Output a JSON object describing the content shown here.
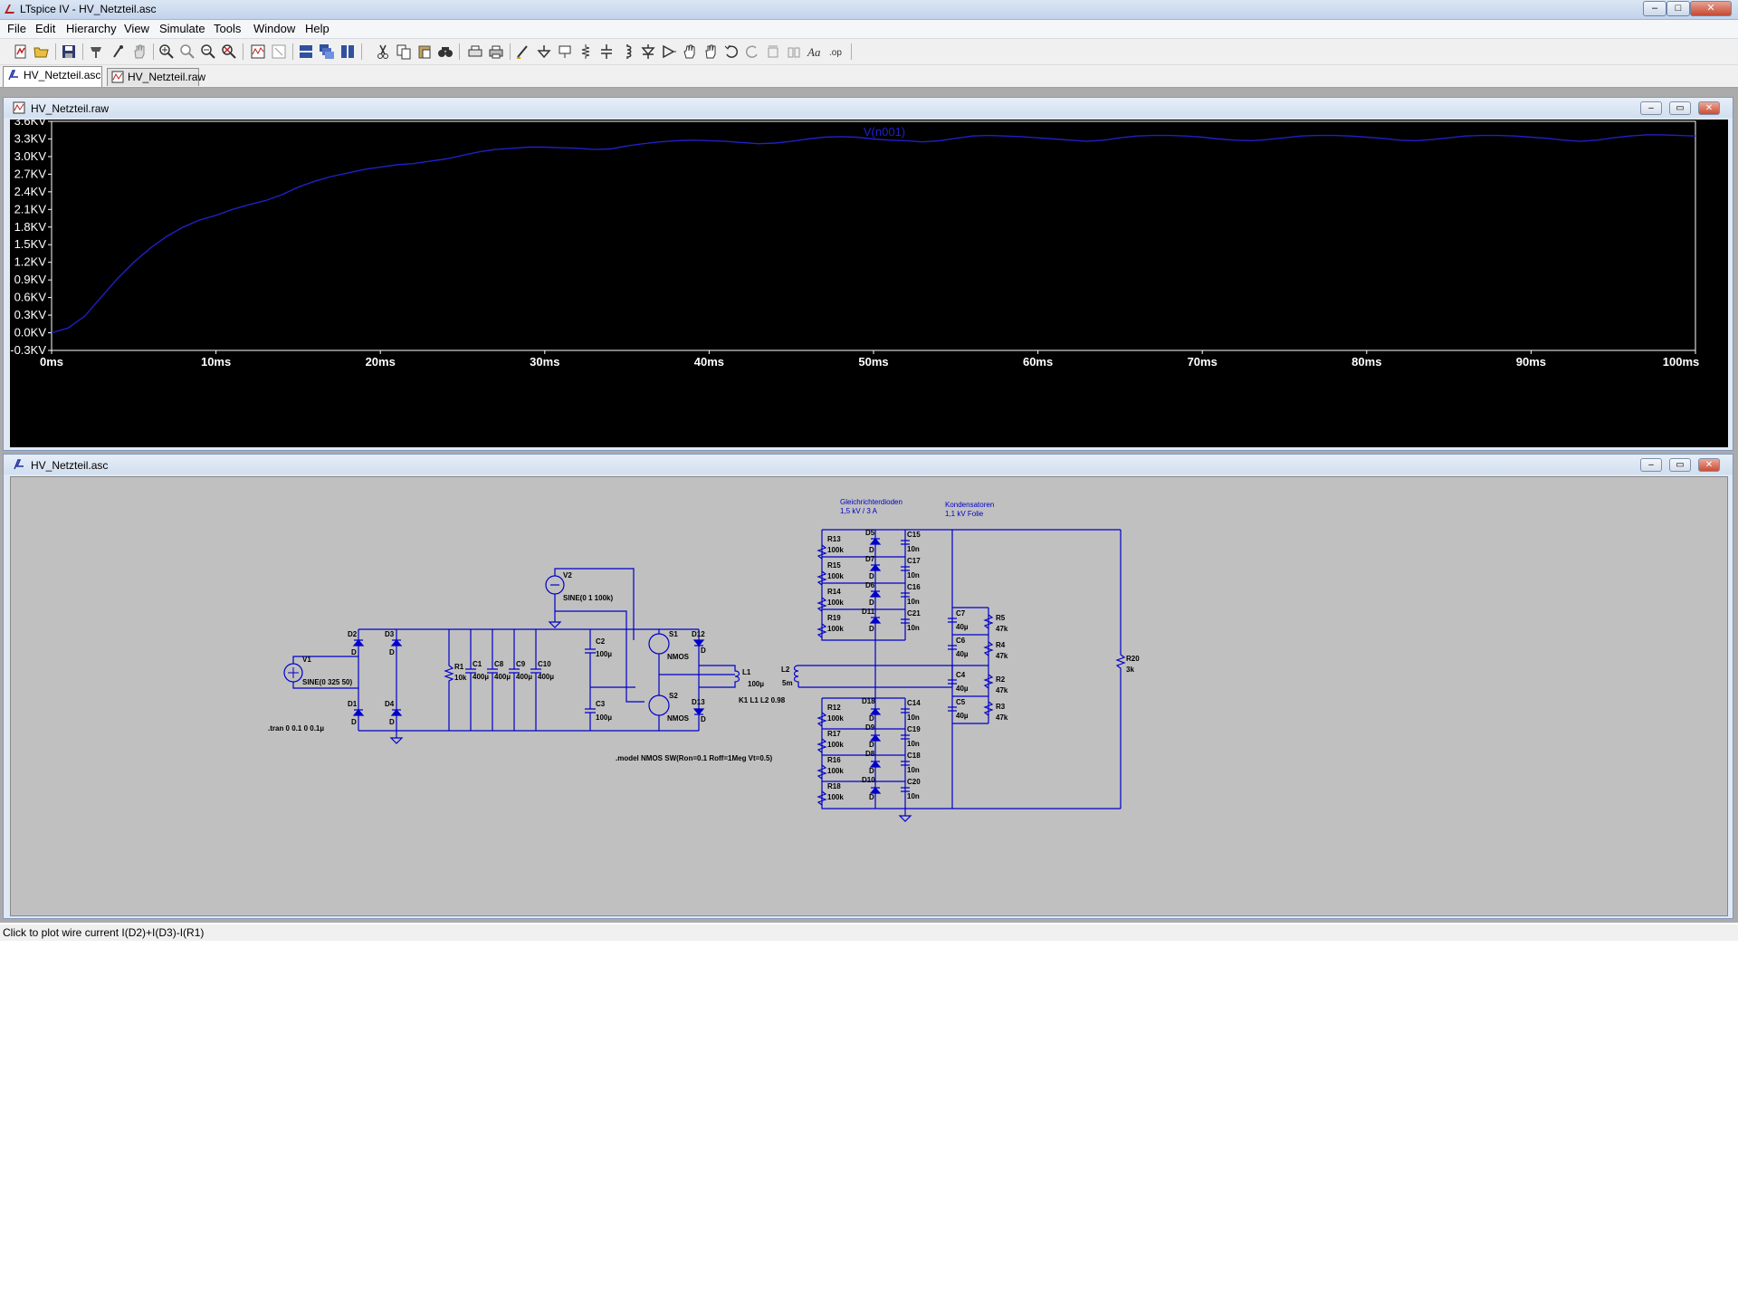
{
  "window": {
    "title": "LTspice IV - HV_Netzteil.asc",
    "min": "–",
    "max": "□",
    "close": "✕"
  },
  "menu": [
    "File",
    "Edit",
    "Hierarchy",
    "View",
    "Simulate",
    "Tools",
    "Window",
    "Help"
  ],
  "tabs": [
    {
      "label": "HV_Netzteil.asc",
      "active": true
    },
    {
      "label": "HV_Netzteil.raw",
      "active": false
    }
  ],
  "plot_window": {
    "title": "HV_Netzteil.raw",
    "trace_label": "V(n001)",
    "min": "–",
    "restore": "▭",
    "close": "✕"
  },
  "chart_data": {
    "type": "line",
    "series": [
      {
        "name": "V(n001)",
        "x": [
          0,
          1,
          2,
          3,
          4,
          5,
          6,
          7,
          8,
          9,
          10,
          11,
          12,
          13,
          14,
          15,
          16,
          17,
          18,
          19,
          20,
          21,
          22,
          23,
          24,
          25,
          26,
          27,
          28,
          29,
          30,
          31,
          32,
          33,
          34,
          35,
          36,
          37,
          38,
          39,
          40,
          41,
          42,
          43,
          44,
          45,
          46,
          47,
          48,
          49,
          50,
          51,
          52,
          53,
          54,
          55,
          56,
          57,
          58,
          59,
          60,
          61,
          62,
          63,
          64,
          65,
          66,
          67,
          68,
          69,
          70,
          71,
          72,
          73,
          74,
          75,
          76,
          77,
          78,
          79,
          80,
          81,
          82,
          83,
          84,
          85,
          86,
          87,
          88,
          89,
          90,
          91,
          92,
          93,
          94,
          95,
          96,
          97,
          98,
          99,
          100
        ],
        "y": [
          0.0,
          0.08,
          0.28,
          0.6,
          0.92,
          1.2,
          1.44,
          1.64,
          1.8,
          1.92,
          2.0,
          2.1,
          2.18,
          2.25,
          2.35,
          2.48,
          2.58,
          2.66,
          2.72,
          2.78,
          2.82,
          2.86,
          2.88,
          2.92,
          2.96,
          3.02,
          3.08,
          3.12,
          3.14,
          3.16,
          3.16,
          3.15,
          3.14,
          3.12,
          3.13,
          3.18,
          3.22,
          3.25,
          3.27,
          3.28,
          3.27,
          3.26,
          3.24,
          3.22,
          3.23,
          3.26,
          3.3,
          3.33,
          3.34,
          3.33,
          3.3,
          3.28,
          3.27,
          3.25,
          3.27,
          3.31,
          3.35,
          3.36,
          3.35,
          3.34,
          3.32,
          3.3,
          3.28,
          3.26,
          3.28,
          3.32,
          3.35,
          3.36,
          3.36,
          3.35,
          3.33,
          3.3,
          3.28,
          3.27,
          3.29,
          3.32,
          3.35,
          3.36,
          3.36,
          3.35,
          3.33,
          3.31,
          3.28,
          3.27,
          3.29,
          3.32,
          3.35,
          3.36,
          3.36,
          3.35,
          3.33,
          3.31,
          3.28,
          3.26,
          3.28,
          3.32,
          3.35,
          3.37,
          3.37,
          3.36,
          3.35
        ]
      }
    ],
    "xlim": [
      0,
      100
    ],
    "ylim": [
      -0.3,
      3.6
    ],
    "xticks": [
      0,
      10,
      20,
      30,
      40,
      50,
      60,
      70,
      80,
      90,
      100
    ],
    "xtick_labels": [
      "0ms",
      "10ms",
      "20ms",
      "30ms",
      "40ms",
      "50ms",
      "60ms",
      "70ms",
      "80ms",
      "90ms",
      "100ms"
    ],
    "yticks": [
      3.6,
      3.3,
      3.0,
      2.7,
      2.4,
      2.1,
      1.8,
      1.5,
      1.2,
      0.9,
      0.6,
      0.3,
      0.0,
      -0.3
    ],
    "ytick_labels": [
      "3.6KV",
      "3.3KV",
      "3.0KV",
      "2.7KV",
      "2.4KV",
      "2.1KV",
      "1.8KV",
      "1.5KV",
      "1.2KV",
      "0.9KV",
      "0.6KV",
      "0.3KV",
      "0.0KV",
      "-0.3KV"
    ],
    "grid": false,
    "line_color": "#2020c8",
    "background": "#000000"
  },
  "schematic_window": {
    "title": "HV_Netzteil.asc",
    "min": "–",
    "restore": "▭",
    "close": "✕"
  },
  "schematic": {
    "notes": {
      "rectifier_title": "Gleichrichterdioden",
      "rectifier_sub": "1,5 kV / 3 A",
      "cap_title": "Kondensatoren",
      "cap_sub": "1,1 kV Folie",
      "tran": ".tran 0 0.1 0 0.1µ",
      "model": ".model NMOS SW(Ron=0.1 Roff=1Meg Vt=0.5)",
      "coupling": "K1 L1 L2 0.98"
    },
    "sources": {
      "v1_name": "V1",
      "v1_value": "SINE(0 325 50)",
      "v2_name": "V2",
      "v2_value": "SINE(0 1 100k)"
    },
    "bridge": [
      "D2",
      "D3",
      "D1",
      "D4"
    ],
    "bridge_value": "D",
    "input_parts": [
      {
        "name": "R1",
        "value": "10k"
      },
      {
        "name": "C1",
        "value": "400µ"
      },
      {
        "name": "C8",
        "value": "400µ"
      },
      {
        "name": "C9",
        "value": "400µ"
      },
      {
        "name": "C10",
        "value": "400µ"
      }
    ],
    "half_bridge": {
      "c2": "C2",
      "c2v": "100µ",
      "c3": "C3",
      "c3v": "100µ",
      "s1": "S1",
      "s2": "S2",
      "model": "NMOS",
      "d12": "D12",
      "d13": "D13",
      "dv": "D",
      "l1": "L1",
      "l1v": "100µ",
      "l2": "L2",
      "l2v": "5m"
    },
    "upper_stack": [
      {
        "r": "R13",
        "rv": "100k",
        "d": "D5",
        "dv": "D",
        "c": "C15",
        "cv": "10n"
      },
      {
        "r": "R15",
        "rv": "100k",
        "d": "D7",
        "dv": "D",
        "c": "C17",
        "cv": "10n"
      },
      {
        "r": "R14",
        "rv": "100k",
        "d": "D6",
        "dv": "D",
        "c": "C16",
        "cv": "10n"
      },
      {
        "r": "R19",
        "rv": "100k",
        "d": "D11",
        "dv": "D",
        "c": "C21",
        "cv": "10n"
      }
    ],
    "lower_stack": [
      {
        "r": "R12",
        "rv": "100k",
        "d": "D18",
        "dv": "D",
        "c": "C14",
        "cv": "10n"
      },
      {
        "r": "R17",
        "rv": "100k",
        "d": "D9",
        "dv": "D",
        "c": "C19",
        "cv": "10n"
      },
      {
        "r": "R16",
        "rv": "100k",
        "d": "D8",
        "dv": "D",
        "c": "C18",
        "cv": "10n"
      },
      {
        "r": "R18",
        "rv": "100k",
        "d": "D10",
        "dv": "D",
        "c": "C20",
        "cv": "10n"
      }
    ],
    "output_caps": [
      {
        "c": "C7",
        "cv": "40µ",
        "r": "R5",
        "rv": "47k"
      },
      {
        "c": "C6",
        "cv": "40µ",
        "r": "R4",
        "rv": "47k"
      },
      {
        "c": "C4",
        "cv": "40µ",
        "r": "R2",
        "rv": "47k"
      },
      {
        "c": "C5",
        "cv": "40µ",
        "r": "R3",
        "rv": "47k"
      }
    ],
    "load": {
      "name": "R20",
      "value": "3k"
    }
  },
  "status": "Click to plot wire current I(D2)+I(D3)-I(R1)"
}
